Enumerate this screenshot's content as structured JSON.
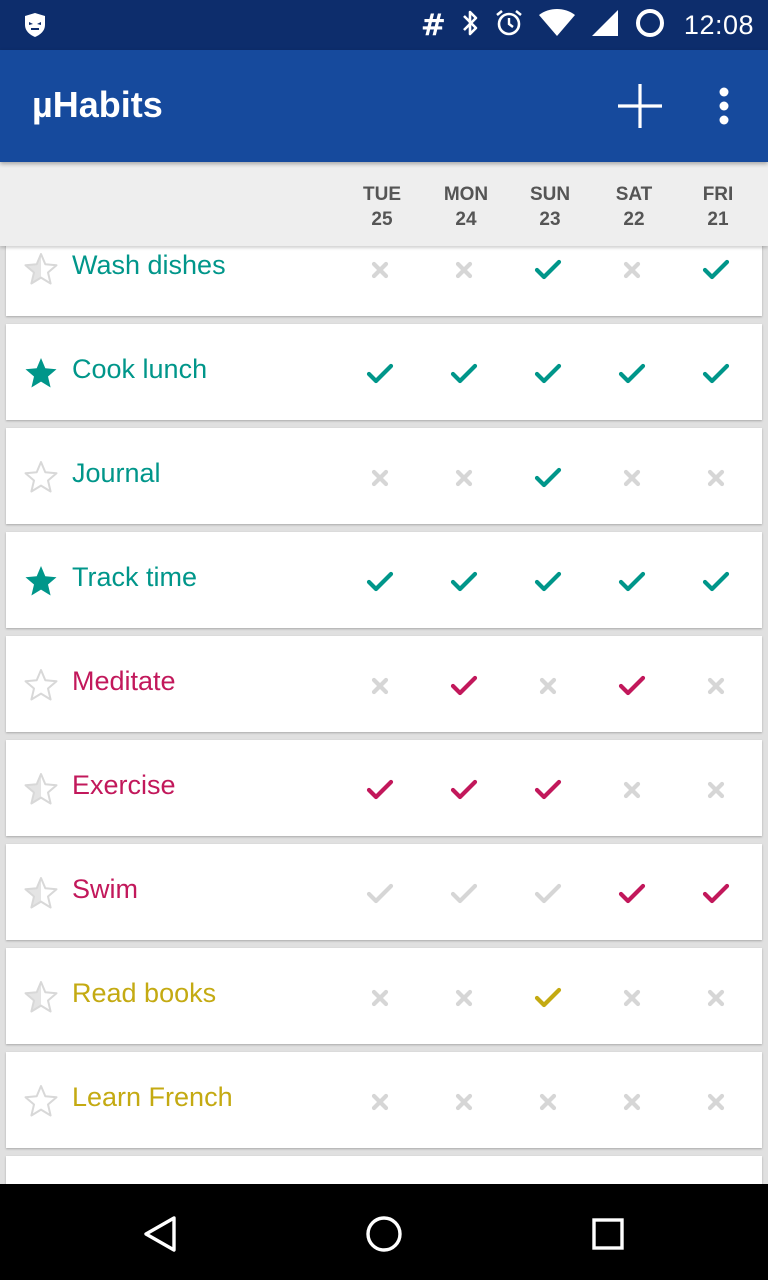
{
  "status_bar": {
    "time": "12:08",
    "hash_symbol": "#",
    "icons": [
      "app-notification-icon",
      "bluetooth-icon",
      "alarm-icon",
      "wifi-icon",
      "cell-signal-icon",
      "battery-icon"
    ]
  },
  "app_bar": {
    "title": "µHabits",
    "actions": [
      "add-icon",
      "overflow-menu-icon"
    ]
  },
  "days": [
    {
      "weekday": "TUE",
      "date": "25"
    },
    {
      "weekday": "MON",
      "date": "24"
    },
    {
      "weekday": "SUN",
      "date": "23"
    },
    {
      "weekday": "SAT",
      "date": "22"
    },
    {
      "weekday": "FRI",
      "date": "21"
    }
  ],
  "colors": {
    "teal": "#00968a",
    "magenta": "#c2185b",
    "olive": "#c4aa12",
    "inactive": "#d6d6d6",
    "app_bar": "#164a9d",
    "status_bar": "#0d2d6c"
  },
  "habits": [
    {
      "name": "Wash dishes",
      "color": "teal",
      "star": "partial",
      "checks": [
        "x",
        "x",
        "check",
        "x",
        "check"
      ]
    },
    {
      "name": "Cook lunch",
      "color": "teal",
      "star": "full",
      "checks": [
        "check",
        "check",
        "check",
        "check",
        "check"
      ]
    },
    {
      "name": "Journal",
      "color": "teal",
      "star": "empty",
      "checks": [
        "x",
        "x",
        "check",
        "x",
        "x"
      ]
    },
    {
      "name": "Track time",
      "color": "teal",
      "star": "full",
      "checks": [
        "check",
        "check",
        "check",
        "check",
        "check"
      ]
    },
    {
      "name": "Meditate",
      "color": "magenta",
      "star": "empty",
      "checks": [
        "x",
        "check",
        "x",
        "check",
        "x"
      ]
    },
    {
      "name": "Exercise",
      "color": "magenta",
      "star": "partial",
      "checks": [
        "check",
        "check",
        "check",
        "x",
        "x"
      ]
    },
    {
      "name": "Swim",
      "color": "magenta",
      "star": "partial",
      "checks": [
        "implicit",
        "implicit",
        "implicit",
        "check",
        "check"
      ]
    },
    {
      "name": "Read books",
      "color": "olive",
      "star": "partial",
      "checks": [
        "x",
        "x",
        "check",
        "x",
        "x"
      ]
    },
    {
      "name": "Learn French",
      "color": "olive",
      "star": "empty",
      "checks": [
        "x",
        "x",
        "x",
        "x",
        "x"
      ]
    }
  ],
  "nav_bar": [
    "back-icon",
    "home-icon",
    "recents-icon"
  ]
}
